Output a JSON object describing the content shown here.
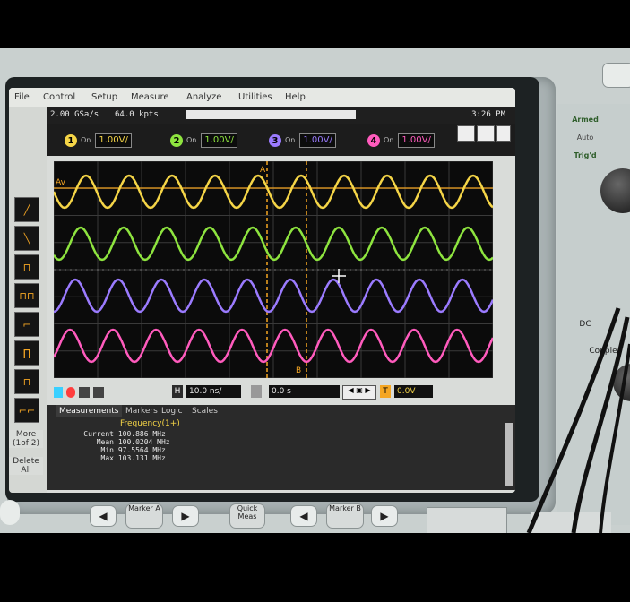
{
  "menu": [
    "File",
    "Control",
    "Setup",
    "Measure",
    "Analyze",
    "Utilities",
    "Help"
  ],
  "status": {
    "sample_rate": "2.00 GSa/s",
    "memory": "64.0 kpts",
    "clock": "3:26 PM"
  },
  "channels": [
    {
      "num": "1",
      "on": "On",
      "scale": "1.00V/",
      "color": "#f5d547"
    },
    {
      "num": "2",
      "on": "On",
      "scale": "1.00V/",
      "color": "#8ee43f"
    },
    {
      "num": "3",
      "on": "On",
      "scale": "1.00V/",
      "color": "#9b7bff"
    },
    {
      "num": "4",
      "on": "On",
      "scale": "1.00V/",
      "color": "#ff5bbd"
    }
  ],
  "markers": {
    "a": "A",
    "b": "B",
    "av": "Av"
  },
  "left_tools": [
    "pos-rise",
    "neg-fall",
    "pulse",
    "pulse-train",
    "clock",
    "pulse-hi",
    "clock2",
    "period"
  ],
  "side_buttons": {
    "more": "More (1of 2)",
    "delete": "Delete All"
  },
  "timebase": {
    "h_label": "H",
    "scale": "10.0 ns/",
    "delay": "0.0 s",
    "trig_label": "T",
    "trig_level": "0.0V"
  },
  "tabs": [
    "Measurements",
    "Markers",
    "Logic",
    "Scales"
  ],
  "measurement": {
    "title": "Frequency(1+)",
    "rows": [
      {
        "label": "Current",
        "value": "100.886 MHz"
      },
      {
        "label": "Mean",
        "value": "100.0204 MHz"
      },
      {
        "label": "Min",
        "value": "97.5564 MHz"
      },
      {
        "label": "Max",
        "value": "103.131 MHz"
      }
    ]
  },
  "right_panel": {
    "armed": "Armed",
    "auto": "Auto",
    "trigd": "Trig'd",
    "dc": "DC",
    "couple": "Couple"
  },
  "front_buttons": {
    "marker_a": "Marker A",
    "quick_meas": "Quick Meas",
    "marker_b": "Marker B"
  }
}
